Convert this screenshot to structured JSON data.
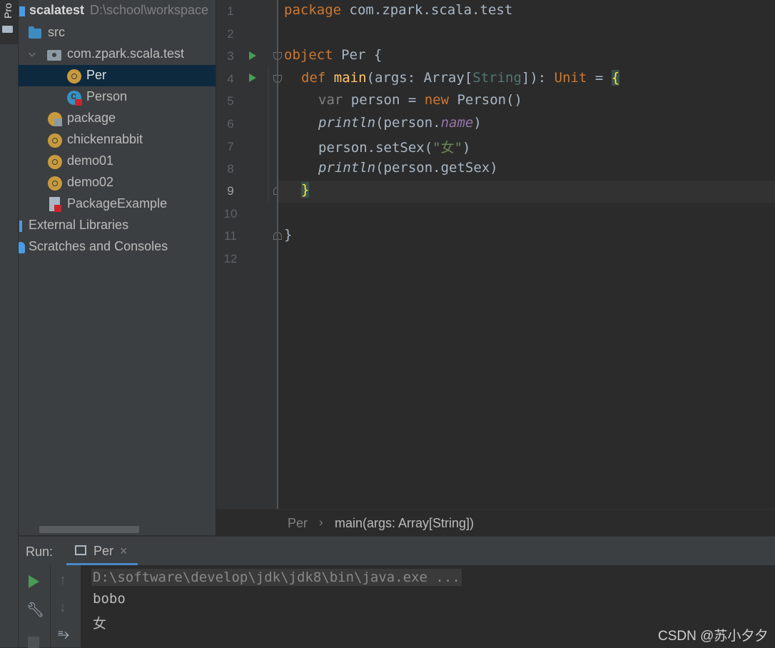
{
  "toolstrip": {
    "project_tab_label": "Pro"
  },
  "project": {
    "root": {
      "name": "scalatest",
      "path": "D:\\school\\workspace"
    },
    "items": [
      {
        "label": "src",
        "icon": "folder-icon"
      },
      {
        "label": "com.zpark.scala.test",
        "icon": "package-icon"
      },
      {
        "label": "Per",
        "icon": "object-icon"
      },
      {
        "label": "Person",
        "icon": "class-icon"
      },
      {
        "label": "package",
        "icon": "package-object-icon"
      },
      {
        "label": "chickenrabbit",
        "icon": "object-icon"
      },
      {
        "label": "demo01",
        "icon": "object-icon"
      },
      {
        "label": "demo02",
        "icon": "object-icon"
      },
      {
        "label": "PackageExample",
        "icon": "file-icon"
      },
      {
        "label": "External Libraries",
        "icon": "library-icon"
      },
      {
        "label": "Scratches and Consoles",
        "icon": "scratches-icon"
      }
    ]
  },
  "editor": {
    "line_numbers": [
      "1",
      "2",
      "3",
      "4",
      "5",
      "6",
      "7",
      "8",
      "9",
      "10",
      "11",
      "12"
    ],
    "current_line": "9",
    "code": {
      "l1_kw": "package",
      "l1_rest": " com.zpark.scala.test",
      "l3_kw": "object",
      "l3_rest": " Per {",
      "l4_kw": "def",
      "l4_fn": "main",
      "l4_a": "(args: Array[",
      "l4_type": "String",
      "l4_b": "]): ",
      "l4_unit": "Unit",
      "l4_c": " = ",
      "l4_brace": "{",
      "l5_var": "var",
      "l5_a": " person = ",
      "l5_new": "new",
      "l5_b": " Person()",
      "l6_fn": "println",
      "l6_a": "(person.",
      "l6_field": "name",
      "l6_b": ")",
      "l7_a": "person.setSex(",
      "l7_str": "\"女\"",
      "l7_b": ")",
      "l8_fn": "println",
      "l8_a": "(person.getSex)",
      "l9_brace": "}",
      "l11": "}"
    },
    "breadcrumb": {
      "item1": "Per",
      "separator": "›",
      "item2": "main(args: Array[String])"
    }
  },
  "run_panel": {
    "label": "Run:",
    "tab_label": "Per",
    "tab_close": "×",
    "console_lines": [
      "D:\\software\\develop\\jdk\\jdk8\\bin\\java.exe ...",
      "bobo",
      "女"
    ]
  },
  "watermark": "CSDN @苏小夕夕",
  "colors": {
    "keyword": "#cc7832",
    "function": "#ffc66d",
    "string": "#6a8759",
    "field": "#9876aa",
    "run_green": "#499c54",
    "selection": "#0d293e"
  }
}
